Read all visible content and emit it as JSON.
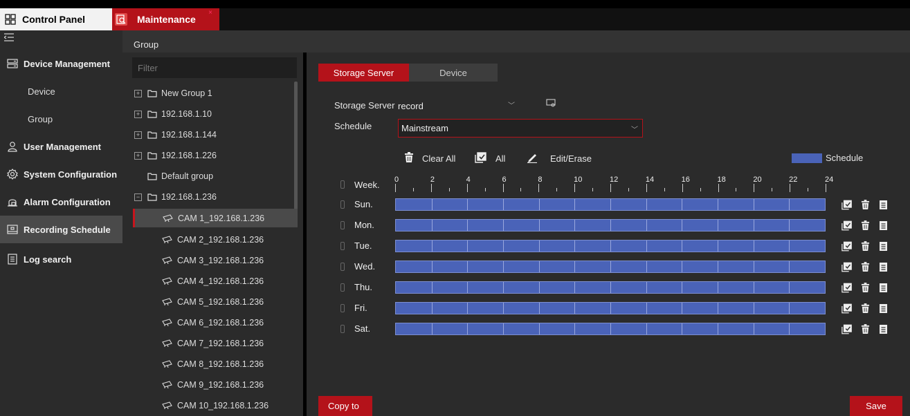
{
  "top_tabs": {
    "control_panel": "Control Panel",
    "maintenance": "Maintenance",
    "close": "×"
  },
  "sidebar": {
    "items": [
      {
        "label": "Device Management",
        "icon": "device-management-icon"
      },
      {
        "label": "Device"
      },
      {
        "label": "Group"
      },
      {
        "label": "User Management",
        "icon": "user-icon"
      },
      {
        "label": "System Configuration",
        "icon": "gear-icon"
      },
      {
        "label": "Alarm Configuration",
        "icon": "alarm-icon"
      },
      {
        "label": "Recording Schedule",
        "icon": "recording-icon",
        "active": true
      },
      {
        "label": "Log search",
        "icon": "log-icon"
      }
    ]
  },
  "group_panel": {
    "title": "Group",
    "filter_placeholder": "Filter",
    "tree": [
      {
        "label": "New Group 1",
        "type": "group"
      },
      {
        "label": "192.168.1.10",
        "type": "group"
      },
      {
        "label": "192.168.1.144",
        "type": "group"
      },
      {
        "label": "192.168.1.226",
        "type": "group"
      },
      {
        "label": "Default group",
        "type": "folder"
      },
      {
        "label": "192.168.1.236",
        "type": "group"
      },
      {
        "label": "CAM 1_192.168.1.236",
        "type": "camera",
        "selected": true
      },
      {
        "label": "CAM 2_192.168.1.236",
        "type": "camera"
      },
      {
        "label": "CAM 3_192.168.1.236",
        "type": "camera"
      },
      {
        "label": "CAM 4_192.168.1.236",
        "type": "camera"
      },
      {
        "label": "CAM 5_192.168.1.236",
        "type": "camera"
      },
      {
        "label": "CAM 6_192.168.1.236",
        "type": "camera"
      },
      {
        "label": "CAM 7_192.168.1.236",
        "type": "camera"
      },
      {
        "label": "CAM 8_192.168.1.236",
        "type": "camera"
      },
      {
        "label": "CAM 9_192.168.1.236",
        "type": "camera"
      },
      {
        "label": "CAM 10_192.168.1.236",
        "type": "camera"
      }
    ]
  },
  "main": {
    "tabs": {
      "storage_server": "Storage Server",
      "device": "Device"
    },
    "storage_server_label": "Storage Server",
    "storage_server_value": "record",
    "schedule_label": "Schedule",
    "schedule_value": "Mainstream",
    "toolbar": {
      "clear_all": "Clear All",
      "all": "All",
      "edit_erase": "Edit/Erase"
    },
    "legend": {
      "label": "Schedule",
      "color": "#4a63b8"
    },
    "week_label": "Week.",
    "hour_ticks": [
      "0",
      "2",
      "4",
      "6",
      "8",
      "10",
      "12",
      "14",
      "16",
      "18",
      "20",
      "22",
      "24"
    ],
    "days": [
      "Sun.",
      "Mon.",
      "Tue.",
      "Wed.",
      "Thu.",
      "Fri.",
      "Sat."
    ],
    "schedule_coverage": "00:00-24:00 all days",
    "copy_to": "Copy to",
    "save": "Save"
  },
  "colors": {
    "accent": "#b4121a",
    "schedule": "#4a63b8"
  }
}
